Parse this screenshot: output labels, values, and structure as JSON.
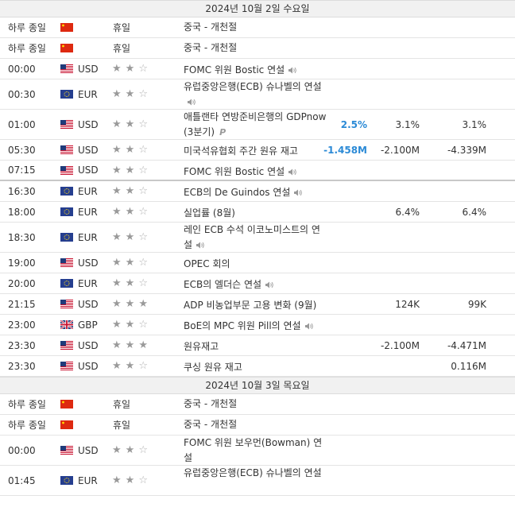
{
  "colors": {
    "actual_up": "#2b8ad6",
    "actual_down": "#2b8ad6"
  },
  "sections": [
    {
      "date": "2024년 10월 2일 수요일",
      "rows": [
        {
          "type": "holiday",
          "time": "하루 종일",
          "flag": "cn-flag-icon",
          "holiday": "휴일",
          "event": "중국 - 개천절"
        },
        {
          "type": "holiday",
          "time": "하루 종일",
          "flag": "cn-flag-icon",
          "holiday": "휴일",
          "event": "중국 - 개천절"
        },
        {
          "type": "event",
          "time": "00:00",
          "flag": "us-flag-icon",
          "currency": "USD",
          "stars": 2,
          "event": "FOMC 위원 Bostic 연설",
          "speech": true,
          "actual": "",
          "forecast": "",
          "previous": ""
        },
        {
          "type": "event",
          "tall": true,
          "time": "00:30",
          "flag": "eu-flag-icon",
          "currency": "EUR",
          "stars": 2,
          "event": "유럽중앙은행(ECB) 슈나벨의 연설",
          "speech": true,
          "actual": "",
          "forecast": "",
          "previous": ""
        },
        {
          "type": "event",
          "tall": true,
          "time": "01:00",
          "flag": "us-flag-icon",
          "currency": "USD",
          "stars": 2,
          "event": "애틀랜타 연방준비은행의 GDPnow (3분기)",
          "prelim": "P",
          "speech": false,
          "actual": "2.5%",
          "forecast": "3.1%",
          "previous": "3.1%"
        },
        {
          "type": "event",
          "time": "05:30",
          "flag": "us-flag-icon",
          "currency": "USD",
          "stars": 2,
          "event": "미국석유협회 주간 원유 재고",
          "speech": false,
          "actual": "-1.458M",
          "forecast": "-2.100M",
          "previous": "-4.339M"
        },
        {
          "type": "event",
          "sep": true,
          "time": "07:15",
          "flag": "us-flag-icon",
          "currency": "USD",
          "stars": 2,
          "event": "FOMC 위원 Bostic 연설",
          "speech": true,
          "actual": "",
          "forecast": "",
          "previous": ""
        },
        {
          "type": "event",
          "time": "16:30",
          "flag": "eu-flag-icon",
          "currency": "EUR",
          "stars": 2,
          "event": "ECB의 De Guindos 연설",
          "speech": true,
          "actual": "",
          "forecast": "",
          "previous": ""
        },
        {
          "type": "event",
          "time": "18:00",
          "flag": "eu-flag-icon",
          "currency": "EUR",
          "stars": 2,
          "event": "실업률 (8월)",
          "speech": false,
          "actual": "",
          "forecast": "6.4%",
          "previous": "6.4%"
        },
        {
          "type": "event",
          "tall": true,
          "time": "18:30",
          "flag": "eu-flag-icon",
          "currency": "EUR",
          "stars": 2,
          "event": "레인 ECB 수석 이코노미스트의 연설",
          "speech": true,
          "actual": "",
          "forecast": "",
          "previous": ""
        },
        {
          "type": "event",
          "time": "19:00",
          "flag": "us-flag-icon",
          "currency": "USD",
          "stars": 2,
          "event": "OPEC 회의",
          "speech": false,
          "actual": "",
          "forecast": "",
          "previous": ""
        },
        {
          "type": "event",
          "time": "20:00",
          "flag": "eu-flag-icon",
          "currency": "EUR",
          "stars": 2,
          "event": "ECB의 엘더슨 연설",
          "speech": true,
          "actual": "",
          "forecast": "",
          "previous": ""
        },
        {
          "type": "event",
          "time": "21:15",
          "flag": "us-flag-icon",
          "currency": "USD",
          "stars": 3,
          "event": "ADP 비농업부문 고용 변화 (9월)",
          "speech": false,
          "actual": "",
          "forecast": "124K",
          "previous": "99K"
        },
        {
          "type": "event",
          "time": "23:00",
          "flag": "gb-flag-icon",
          "currency": "GBP",
          "stars": 2,
          "event": "BoE의 MPC 위원 Pill의 연설",
          "speech": true,
          "actual": "",
          "forecast": "",
          "previous": ""
        },
        {
          "type": "event",
          "time": "23:30",
          "flag": "us-flag-icon",
          "currency": "USD",
          "stars": 3,
          "event": "원유재고",
          "speech": false,
          "actual": "",
          "forecast": "-2.100M",
          "previous": "-4.471M"
        },
        {
          "type": "event",
          "time": "23:30",
          "flag": "us-flag-icon",
          "currency": "USD",
          "stars": 2,
          "event": "쿠싱 원유 재고",
          "speech": false,
          "actual": "",
          "forecast": "",
          "previous": "0.116M"
        }
      ]
    },
    {
      "date": "2024년 10월 3일 목요일",
      "rows": [
        {
          "type": "holiday",
          "time": "하루 종일",
          "flag": "cn-flag-icon",
          "holiday": "휴일",
          "event": "중국 - 개천절"
        },
        {
          "type": "holiday",
          "time": "하루 종일",
          "flag": "cn-flag-icon",
          "holiday": "휴일",
          "event": "중국 - 개천절"
        },
        {
          "type": "event",
          "tall": true,
          "time": "00:00",
          "flag": "us-flag-icon",
          "currency": "USD",
          "stars": 2,
          "event": "FOMC 위원 보우먼(Bowman) 연설",
          "speech": false,
          "actual": "",
          "forecast": "",
          "previous": ""
        },
        {
          "type": "event",
          "tall": true,
          "time": "01:45",
          "flag": "eu-flag-icon",
          "currency": "EUR",
          "stars": 2,
          "event": "유럽중앙은행(ECB) 슈나벨의 연설",
          "speech": false,
          "actual": "",
          "forecast": "",
          "previous": ""
        }
      ]
    }
  ]
}
